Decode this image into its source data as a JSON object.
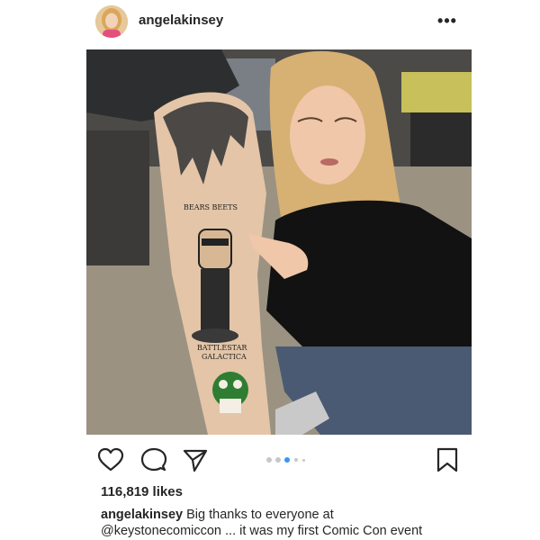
{
  "post": {
    "username": "angelakinsey",
    "more_label": "•••",
    "likes": "116,819 likes",
    "caption": {
      "username": "angelakinsey",
      "text_line1": "Big thanks to everyone at",
      "mention": "@keystonecomiccon",
      "text_line2": " ... it was my first Comic Con event"
    },
    "tattoo_text": {
      "top": "BEARS  BEETS",
      "bottom_line1": "BATTLESTAR",
      "bottom_line2": "GALACTICA"
    },
    "carousel": {
      "count": 5,
      "active_index": 2
    }
  },
  "icons": [
    "heart-icon",
    "comment-icon",
    "share-icon",
    "bookmark-icon",
    "more-icon"
  ],
  "colors": {
    "text": "#262626",
    "dot_active": "#3897f0",
    "dot_inactive": "#c7c7c7",
    "background": "#ffffff"
  }
}
